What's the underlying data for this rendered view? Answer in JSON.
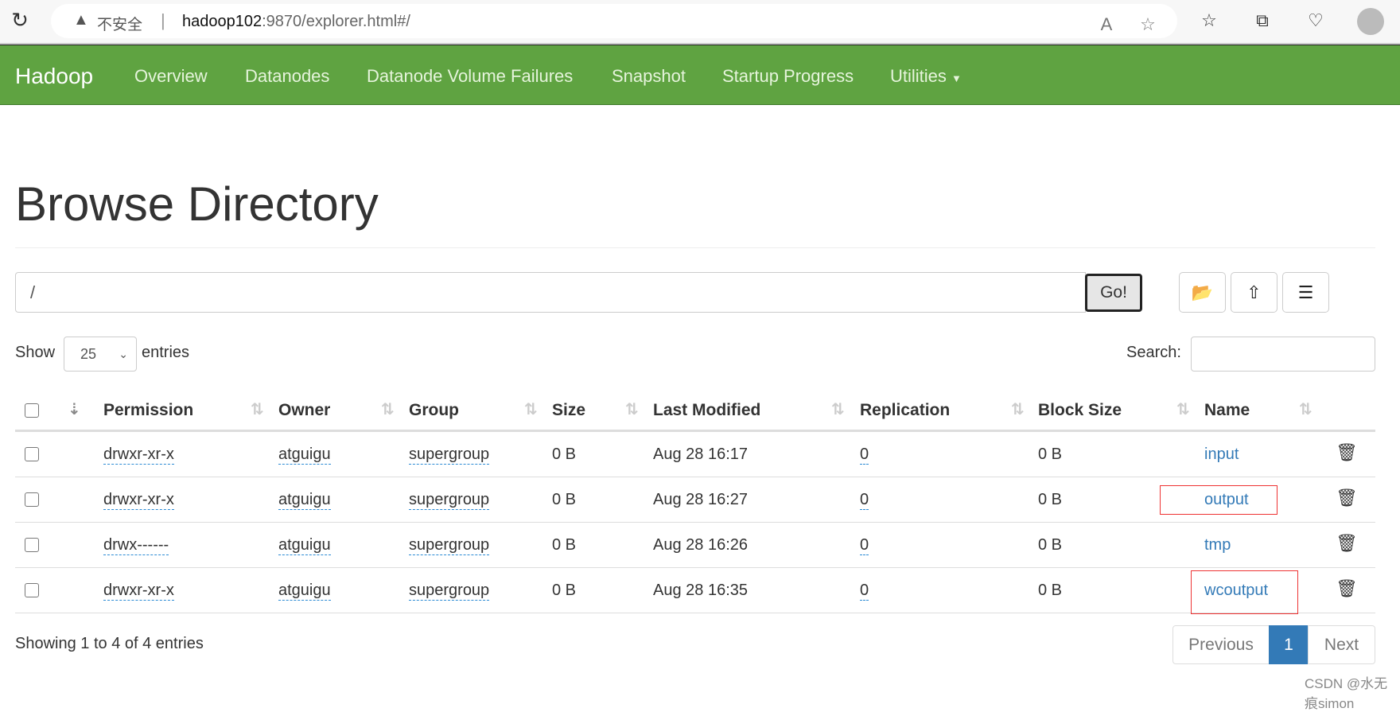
{
  "browser": {
    "insecure_label": "不安全",
    "url_host": "hadoop102",
    "url_rest": ":9870/explorer.html#/",
    "icons": [
      "reload-icon",
      "warning-icon",
      "read-aloud-icon",
      "add-favorite-icon",
      "favorites-icon",
      "collections-icon",
      "browser-essentials-icon",
      "profile-avatar"
    ]
  },
  "navbar": {
    "brand": "Hadoop",
    "items": [
      "Overview",
      "Datanodes",
      "Datanode Volume Failures",
      "Snapshot",
      "Startup Progress",
      "Utilities"
    ],
    "color": "#5fa341"
  },
  "page": {
    "title": "Browse Directory",
    "path_value": "/",
    "go_label": "Go!",
    "action_icons": [
      "folder-open-icon",
      "cloud-upload-icon",
      "list-icon"
    ]
  },
  "controls": {
    "show_label": "Show",
    "page_size": "25",
    "entries_label": "entries",
    "search_label": "Search:",
    "search_value": ""
  },
  "table": {
    "columns": [
      "Permission",
      "Owner",
      "Group",
      "Size",
      "Last Modified",
      "Replication",
      "Block Size",
      "Name"
    ],
    "rows": [
      {
        "permission": "drwxr-xr-x",
        "owner": "atguigu",
        "group": "supergroup",
        "size": "0 B",
        "modified": "Aug 28 16:17",
        "replication": "0",
        "block_size": "0 B",
        "name": "input",
        "highlighted": false
      },
      {
        "permission": "drwxr-xr-x",
        "owner": "atguigu",
        "group": "supergroup",
        "size": "0 B",
        "modified": "Aug 28 16:27",
        "replication": "0",
        "block_size": "0 B",
        "name": "output",
        "highlighted": true
      },
      {
        "permission": "drwx------",
        "owner": "atguigu",
        "group": "supergroup",
        "size": "0 B",
        "modified": "Aug 28 16:26",
        "replication": "0",
        "block_size": "0 B",
        "name": "tmp",
        "highlighted": false
      },
      {
        "permission": "drwxr-xr-x",
        "owner": "atguigu",
        "group": "supergroup",
        "size": "0 B",
        "modified": "Aug 28 16:35",
        "replication": "0",
        "block_size": "0 B",
        "name": "wcoutput",
        "highlighted": true
      }
    ]
  },
  "footer": {
    "info": "Showing 1 to 4 of 4 entries",
    "previous": "Previous",
    "current_page": "1",
    "next": "Next"
  },
  "watermark": "CSDN @水无痕simon"
}
